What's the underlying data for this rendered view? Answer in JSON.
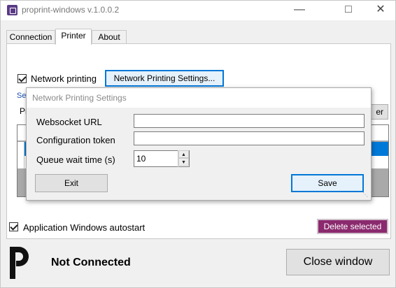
{
  "window": {
    "title": "proprint-windows v.1.0.0.2"
  },
  "tabs": [
    {
      "label": "Connection",
      "active": false
    },
    {
      "label": "Printer",
      "active": true
    },
    {
      "label": "About",
      "active": false
    }
  ],
  "printer_tab": {
    "network_printing_label": "Network printing",
    "network_printing_checked": true,
    "network_settings_button": "Network Printing Settings...",
    "partial_select_label": "Sel",
    "partial_printer_label": "Pr",
    "partial_button_label": "er"
  },
  "dialog": {
    "title": "Network Printing Settings",
    "websocket_label": "Websocket URL",
    "websocket_value": "",
    "token_label": "Configuration token",
    "token_value": "",
    "queue_label": "Queue wait time (s)",
    "queue_value": "10",
    "exit_button": "Exit",
    "save_button": "Save"
  },
  "footer": {
    "autostart_label": "Application Windows autostart",
    "autostart_checked": true,
    "delete_button": "Delete selected",
    "status_text": "Not Connected",
    "close_button": "Close window"
  },
  "colors": {
    "accent": "#0078d7",
    "delete_button": "#8b2a6e",
    "app_icon": "#5a3a86"
  }
}
